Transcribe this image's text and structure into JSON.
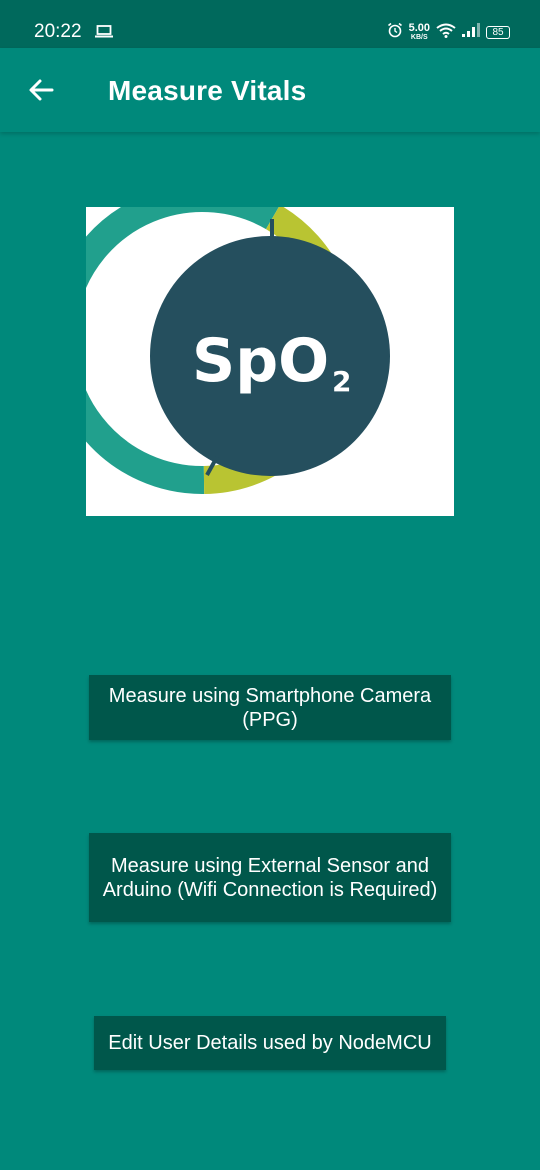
{
  "status_bar": {
    "time": "20:22",
    "net_speed_value": "5.00",
    "net_speed_unit": "KB/S",
    "battery": "85"
  },
  "app_bar": {
    "title": "Measure Vitals"
  },
  "logo": {
    "text": "SpO",
    "subscript": "2"
  },
  "buttons": {
    "camera": "Measure using Smartphone Camera (PPG)",
    "sensor": "Measure using External Sensor and Arduino (Wifi Connection is Required)",
    "edit": "Edit User Details used by NodeMCU"
  },
  "colors": {
    "background": "#00897b",
    "status_bar": "#00695c",
    "button": "#00574b",
    "logo_dark": "#254f5e",
    "logo_teal": "#21a08d",
    "logo_lime": "#b9c432"
  }
}
